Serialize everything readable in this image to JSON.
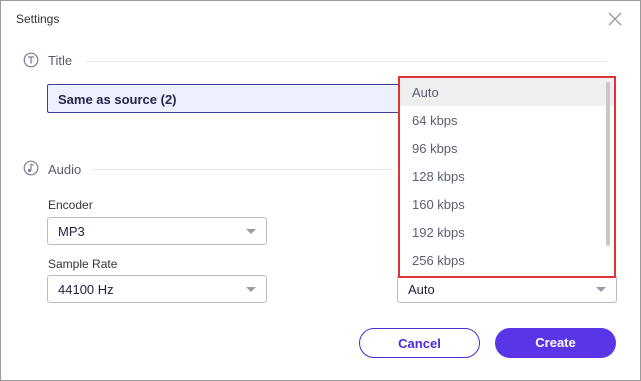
{
  "window": {
    "title": "Settings"
  },
  "title_section": {
    "label": "Title",
    "value": "Same as source (2)"
  },
  "audio_section": {
    "label": "Audio",
    "encoder": {
      "label": "Encoder",
      "value": "MP3"
    },
    "sample_rate": {
      "label": "Sample Rate",
      "value": "44100 Hz"
    },
    "bitrate": {
      "value": "Auto"
    }
  },
  "bitrate_dropdown": {
    "options": [
      "Auto",
      "64 kbps",
      "96 kbps",
      "128 kbps",
      "160 kbps",
      "192 kbps",
      "256 kbps"
    ],
    "selected": "Auto"
  },
  "actions": {
    "cancel_label": "Cancel",
    "create_label": "Create"
  },
  "colors": {
    "accent": "#5a35e8",
    "highlight_border": "#e03333"
  },
  "icons": {
    "close": "close-icon",
    "title": "title-icon",
    "audio": "music-note-icon"
  }
}
